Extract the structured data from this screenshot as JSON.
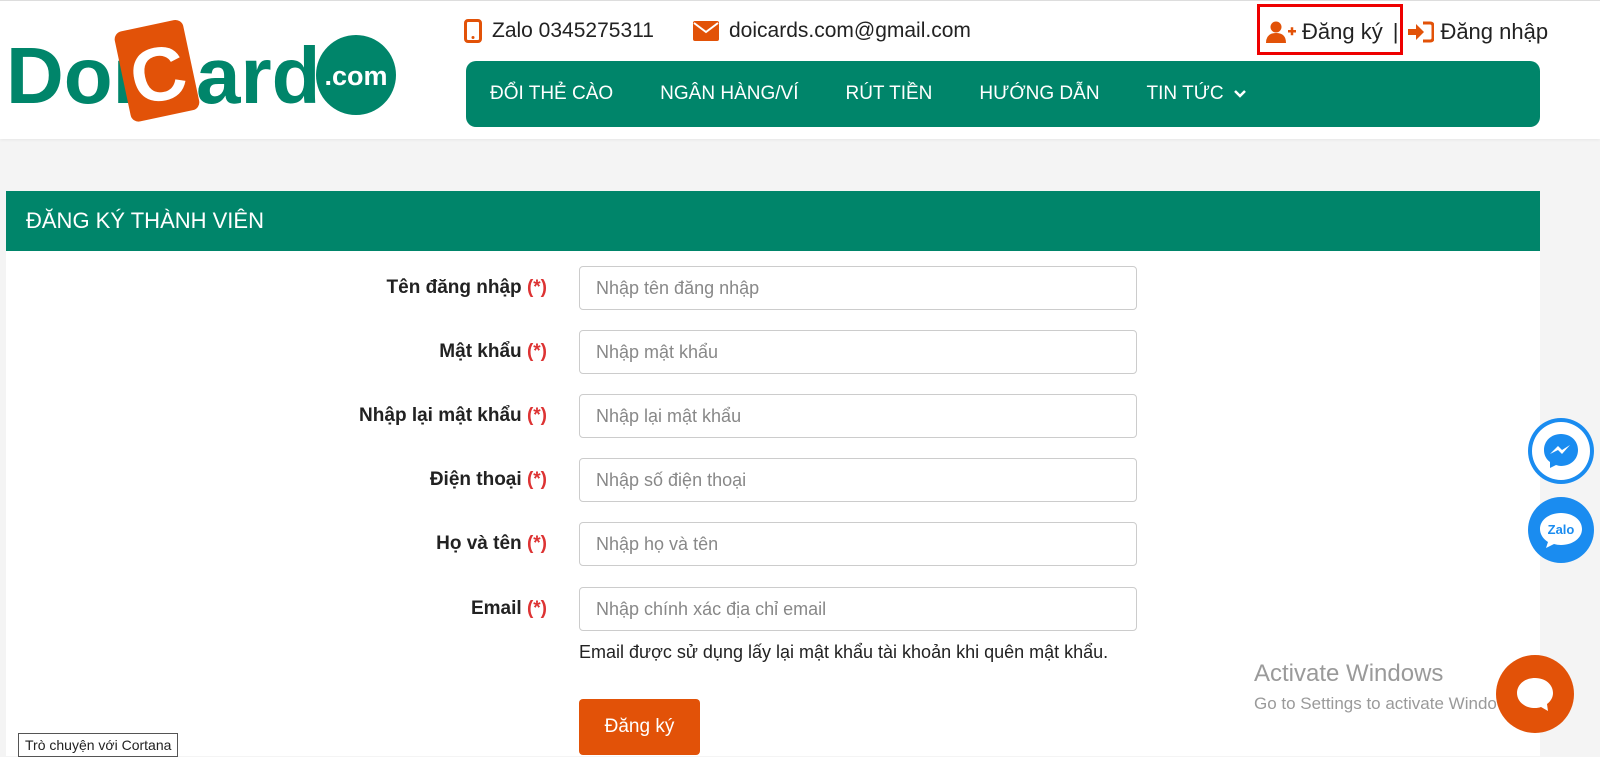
{
  "brand": {
    "primary": "#00856a",
    "accent": "#e25208",
    "required": "#dd3333"
  },
  "logo": {
    "text_doi": "Doi",
    "text_c": "C",
    "text_ards": "ards",
    "text_com": ".com"
  },
  "header": {
    "phone_icon": "mobile-phone-icon",
    "phone": "Zalo 0345275311",
    "mail_icon": "envelope-icon",
    "email": "doicards.com@gmail.com",
    "register_icon": "user-plus-icon",
    "register": "Đăng ký",
    "separator": "|",
    "login_icon": "sign-in-icon",
    "login": "Đăng nhập"
  },
  "nav": {
    "items": [
      {
        "label": "ĐỔI THẺ CÀO"
      },
      {
        "label": "NGÂN HÀNG/VÍ"
      },
      {
        "label": "RÚT TIỀN"
      },
      {
        "label": "HƯỚNG DẪN"
      },
      {
        "label": "TIN TỨC",
        "icon": "chevron-down-icon"
      }
    ]
  },
  "form": {
    "title": "ĐĂNG KÝ THÀNH VIÊN",
    "required_mark": "(*)",
    "fields": [
      {
        "label": "Tên đăng nhập",
        "placeholder": "Nhập tên đăng nhập",
        "value": ""
      },
      {
        "label": "Mật khẩu",
        "placeholder": "Nhập mật khẩu",
        "value": ""
      },
      {
        "label": "Nhập lại mật khẩu",
        "placeholder": "Nhập lại mật khẩu",
        "value": ""
      },
      {
        "label": "Điện thoại",
        "placeholder": "Nhập số điện thoại",
        "value": ""
      },
      {
        "label": "Họ và tên",
        "placeholder": "Nhập họ và tên",
        "value": ""
      },
      {
        "label": "Email",
        "placeholder": "Nhập chính xác địa chỉ email",
        "value": ""
      }
    ],
    "email_help": "Email được sử dụng lấy lại mật khẩu tài khoản khi quên mật khẩu.",
    "submit": "Đăng ký"
  },
  "floating": {
    "messenger_icon": "messenger-icon",
    "zalo_label": "Zalo",
    "chat_icon": "chat-bubble-icon"
  },
  "watermark": {
    "line1": "Activate Windows",
    "line2": "Go to Settings to activate Windows."
  },
  "tooltip": "Trò chuyện với Cortana"
}
